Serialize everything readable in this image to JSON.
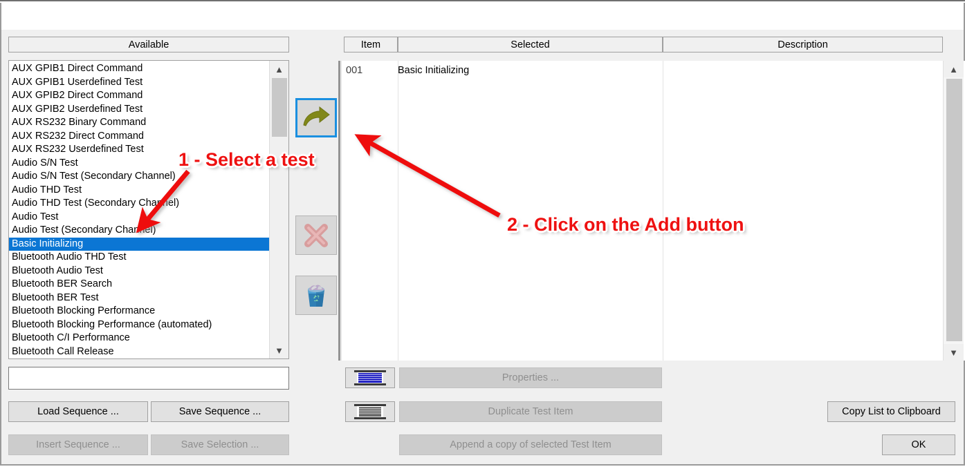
{
  "dialog": {
    "available_header": "Available",
    "available_items": [
      {
        "label": "AUX GPIB1 Direct Command",
        "selected": false
      },
      {
        "label": "AUX GPIB1 Userdefined Test",
        "selected": false
      },
      {
        "label": "AUX GPIB2 Direct Command",
        "selected": false
      },
      {
        "label": "AUX GPIB2 Userdefined Test",
        "selected": false
      },
      {
        "label": "AUX RS232 Binary Command",
        "selected": false
      },
      {
        "label": "AUX RS232 Direct Command",
        "selected": false
      },
      {
        "label": "AUX RS232 Userdefined Test",
        "selected": false
      },
      {
        "label": "Audio S/N Test",
        "selected": false
      },
      {
        "label": "Audio S/N Test (Secondary Channel)",
        "selected": false
      },
      {
        "label": "Audio THD Test",
        "selected": false
      },
      {
        "label": "Audio THD Test (Secondary Channel)",
        "selected": false
      },
      {
        "label": "Audio Test",
        "selected": false
      },
      {
        "label": "Audio Test (Secondary Channel)",
        "selected": false
      },
      {
        "label": "Basic Initializing",
        "selected": true
      },
      {
        "label": "Bluetooth Audio THD Test",
        "selected": false
      },
      {
        "label": "Bluetooth Audio Test",
        "selected": false
      },
      {
        "label": "Bluetooth BER Search",
        "selected": false
      },
      {
        "label": "Bluetooth BER Test",
        "selected": false
      },
      {
        "label": "Bluetooth Blocking Performance",
        "selected": false
      },
      {
        "label": "Bluetooth Blocking Performance (automated)",
        "selected": false
      },
      {
        "label": "Bluetooth C/I Performance",
        "selected": false
      },
      {
        "label": "Bluetooth Call Release",
        "selected": false
      }
    ],
    "filter_value": "",
    "filter_placeholder": "",
    "buttons": {
      "load_sequence": "Load Sequence ...",
      "save_sequence": "Save Sequence ...",
      "insert_sequence": "Insert Sequence ...",
      "save_selection": "Save Selection ...",
      "properties": "Properties ...",
      "duplicate_test_item": "Duplicate Test Item",
      "append_copy": "Append a copy of selected Test Item",
      "copy_list_to_clipboard": "Copy List to Clipboard",
      "ok": "OK"
    },
    "transfer_buttons": [
      {
        "name": "add",
        "icon": "right-arrow-icon",
        "enabled": true,
        "focused": true
      },
      {
        "name": "remove",
        "icon": "red-x-icon",
        "enabled": false,
        "focused": false
      },
      {
        "name": "clear-all",
        "icon": "recycle-bin-icon",
        "enabled": true,
        "focused": false
      }
    ],
    "grid": {
      "columns": [
        "Item",
        "Selected",
        "Description"
      ],
      "rows": [
        {
          "item": "001",
          "selected": "Basic Initializing",
          "description": ""
        }
      ]
    }
  },
  "annotations": [
    {
      "id": "step-1",
      "text": "1 - Select a test"
    },
    {
      "id": "step-2",
      "text": "2 - Click on the Add button"
    }
  ],
  "colors": {
    "selection_blue": "#0b76d4",
    "annotation_red": "#ee1111",
    "focus_border_blue": "#1a8fe0",
    "dialog_background": "#f0f0f0"
  }
}
